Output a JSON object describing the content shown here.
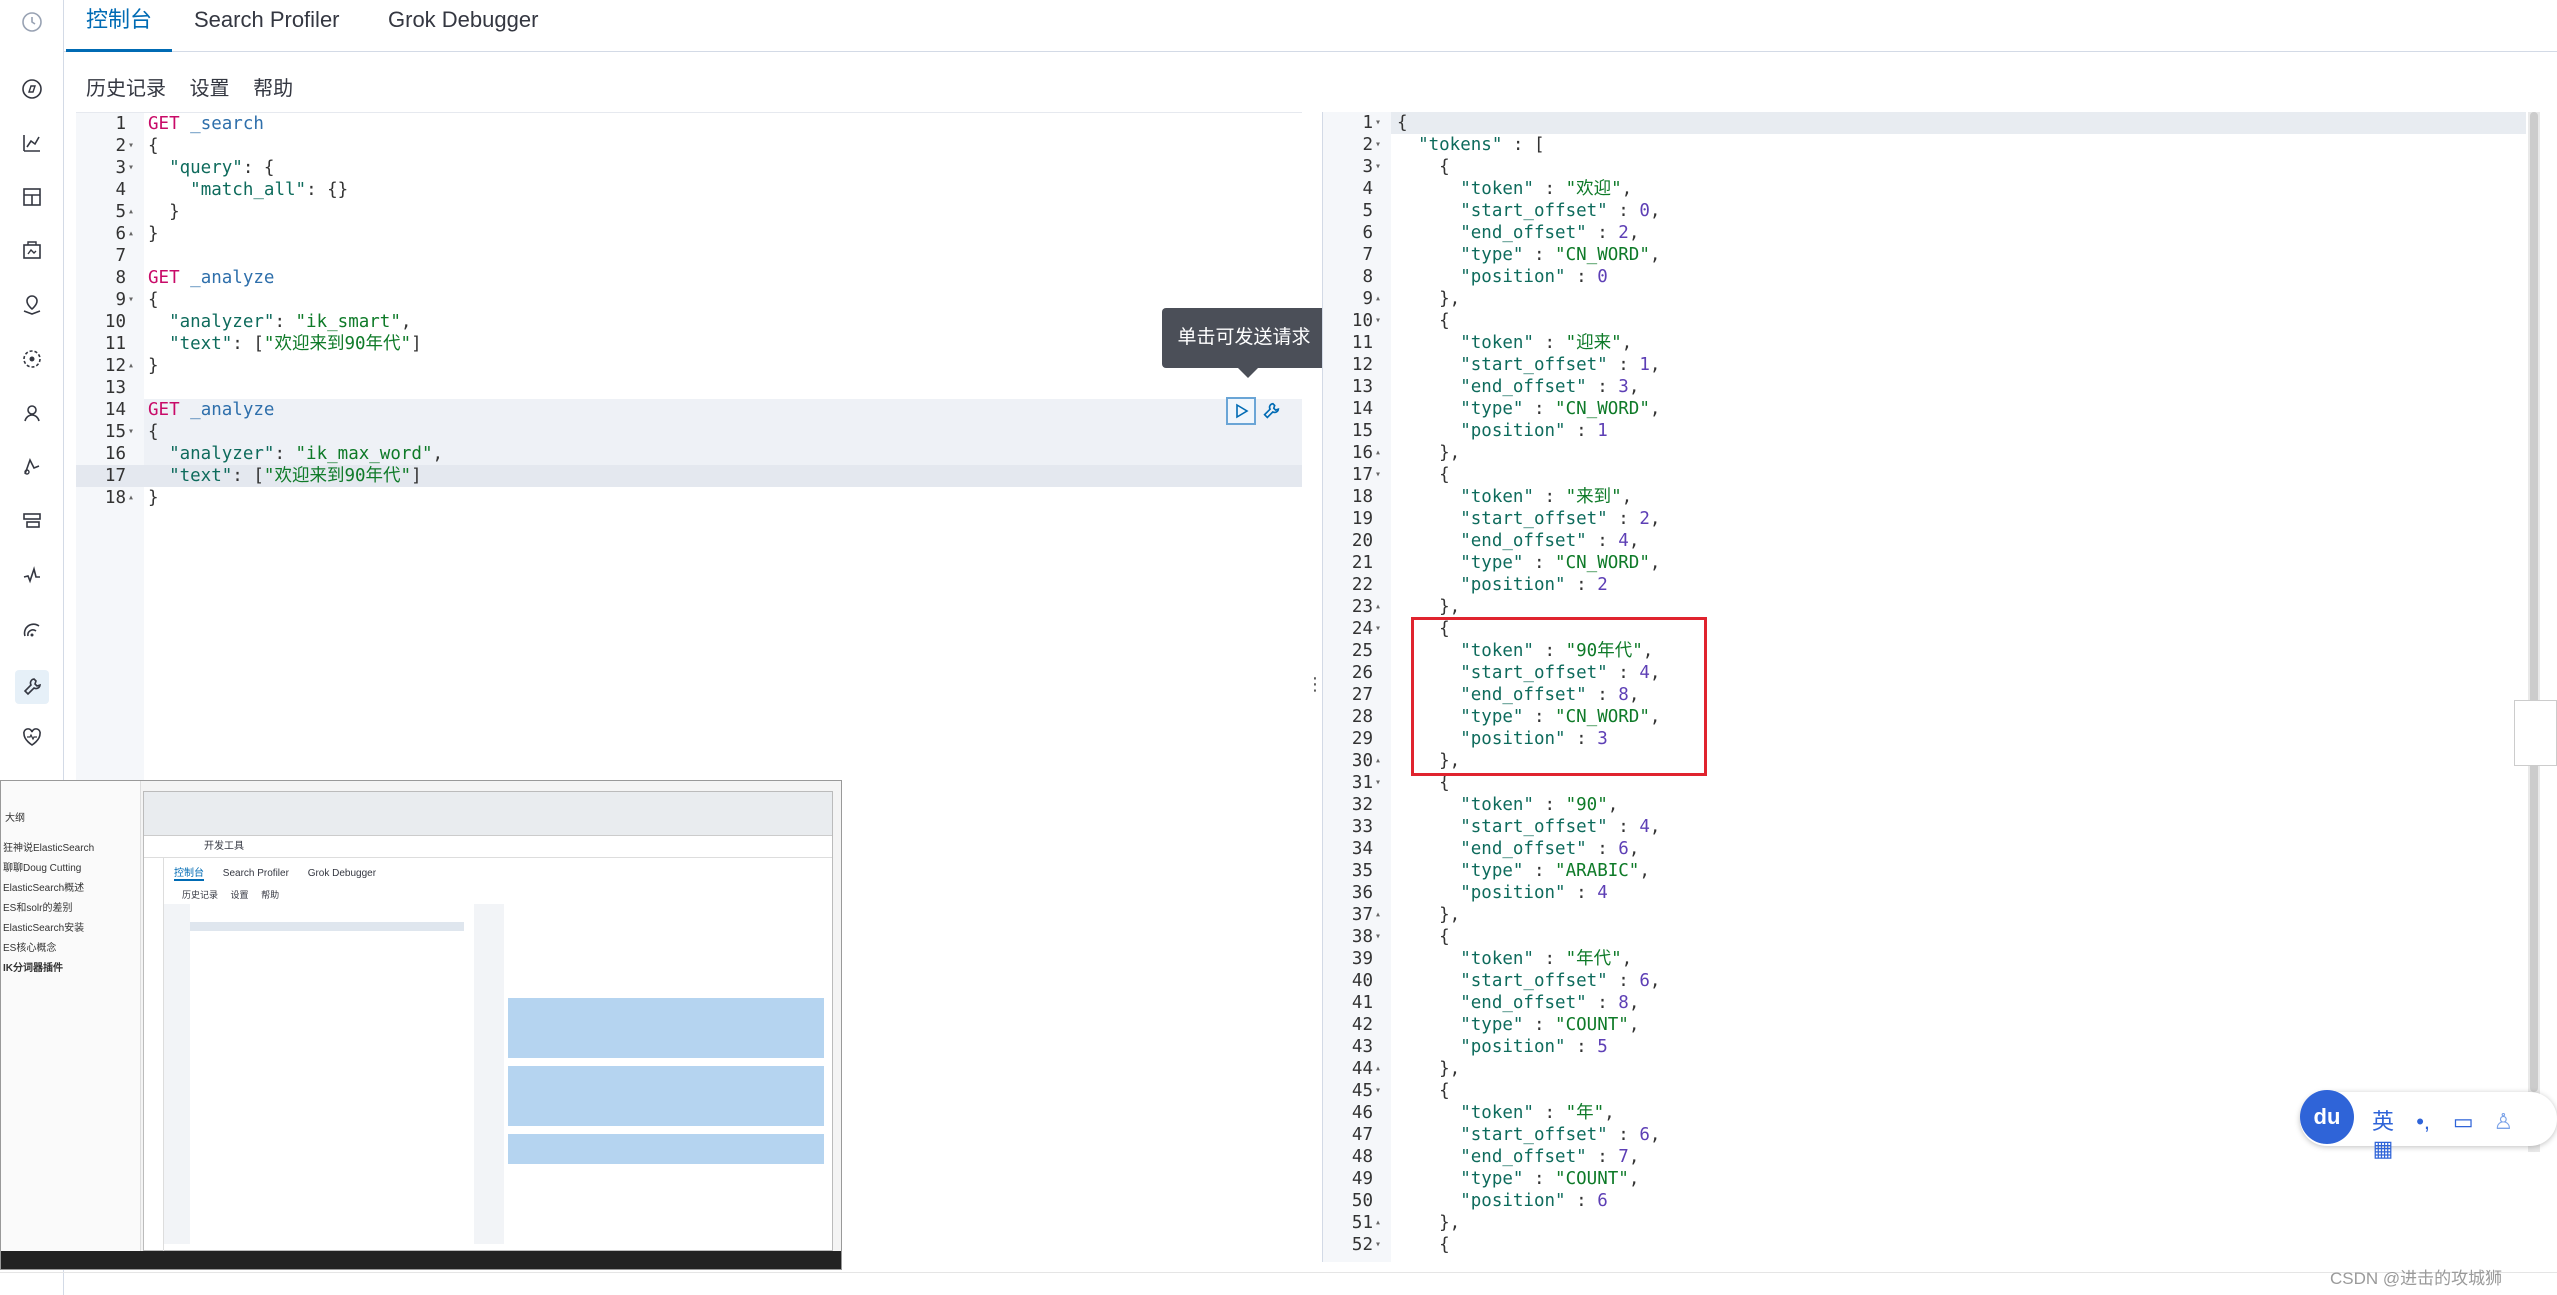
{
  "tabs": {
    "console": "控制台",
    "profiler": "Search Profiler",
    "grok": "Grok Debugger"
  },
  "submenu": {
    "history": "历史记录",
    "settings": "设置",
    "help": "帮助"
  },
  "nav_icons": [
    "compass-icon",
    "visualize-icon",
    "dashboard-icon",
    "canvas-icon",
    "maps-icon",
    "ml-icon",
    "graph-icon",
    "apm-icon",
    "infrastructure-icon",
    "uptime-icon",
    "siem-icon",
    "dev-tools-icon",
    "monitoring-icon"
  ],
  "tooltip": "单击可发送请求",
  "request_lines": [
    {
      "n": "1",
      "fold": "",
      "parts": [
        [
          "k-method",
          "GET "
        ],
        [
          "k-url",
          "_search"
        ]
      ]
    },
    {
      "n": "2",
      "fold": "▾",
      "parts": [
        [
          "k-punc",
          "{"
        ]
      ]
    },
    {
      "n": "3",
      "fold": "▾",
      "parts": [
        [
          "k-punc",
          "  "
        ],
        [
          "k-key",
          "\"query\""
        ],
        [
          "k-punc",
          ": {"
        ]
      ]
    },
    {
      "n": "4",
      "fold": "",
      "parts": [
        [
          "k-punc",
          "    "
        ],
        [
          "k-key",
          "\"match_all\""
        ],
        [
          "k-punc",
          ": {}"
        ]
      ]
    },
    {
      "n": "5",
      "fold": "▴",
      "parts": [
        [
          "k-punc",
          "  }"
        ]
      ]
    },
    {
      "n": "6",
      "fold": "▴",
      "parts": [
        [
          "k-punc",
          "}"
        ]
      ]
    },
    {
      "n": "7",
      "fold": "",
      "parts": []
    },
    {
      "n": "8",
      "fold": "",
      "parts": [
        [
          "k-method",
          "GET "
        ],
        [
          "k-url",
          "_analyze"
        ]
      ]
    },
    {
      "n": "9",
      "fold": "▾",
      "parts": [
        [
          "k-punc",
          "{"
        ]
      ]
    },
    {
      "n": "10",
      "fold": "",
      "parts": [
        [
          "k-punc",
          "  "
        ],
        [
          "k-key",
          "\"analyzer\""
        ],
        [
          "k-punc",
          ": "
        ],
        [
          "k-str",
          "\"ik_smart\""
        ],
        [
          "k-punc",
          ","
        ]
      ]
    },
    {
      "n": "11",
      "fold": "",
      "parts": [
        [
          "k-punc",
          "  "
        ],
        [
          "k-key",
          "\"text\""
        ],
        [
          "k-punc",
          ": ["
        ],
        [
          "k-str",
          "\"欢迎来到90年代\""
        ],
        [
          "k-punc",
          "]"
        ]
      ]
    },
    {
      "n": "12",
      "fold": "▴",
      "parts": [
        [
          "k-punc",
          "}"
        ]
      ]
    },
    {
      "n": "13",
      "fold": "",
      "parts": []
    },
    {
      "n": "14",
      "fold": "",
      "parts": [
        [
          "k-method",
          "GET "
        ],
        [
          "k-url",
          "_analyze"
        ]
      ]
    },
    {
      "n": "15",
      "fold": "▾",
      "parts": [
        [
          "k-punc",
          "{"
        ]
      ]
    },
    {
      "n": "16",
      "fold": "",
      "parts": [
        [
          "k-punc",
          "  "
        ],
        [
          "k-key",
          "\"analyzer\""
        ],
        [
          "k-punc",
          ": "
        ],
        [
          "k-str",
          "\"ik_max_word\""
        ],
        [
          "k-punc",
          ","
        ]
      ]
    },
    {
      "n": "17",
      "fold": "",
      "parts": [
        [
          "k-punc",
          "  "
        ],
        [
          "k-key",
          "\"text\""
        ],
        [
          "k-punc",
          ": ["
        ],
        [
          "k-str",
          "\"欢迎来到90年代\""
        ],
        [
          "k-punc",
          "]"
        ]
      ]
    },
    {
      "n": "18",
      "fold": "▴",
      "parts": [
        [
          "k-punc",
          "}"
        ]
      ]
    }
  ],
  "response_lines": [
    {
      "n": "1",
      "fold": "▾",
      "parts": [
        [
          "k-punc",
          "{"
        ]
      ]
    },
    {
      "n": "2",
      "fold": "▾",
      "parts": [
        [
          "k-punc",
          "  "
        ],
        [
          "k-key",
          "\"tokens\""
        ],
        [
          "k-punc",
          " : ["
        ]
      ]
    },
    {
      "n": "3",
      "fold": "▾",
      "parts": [
        [
          "k-punc",
          "    {"
        ]
      ]
    },
    {
      "n": "4",
      "fold": "",
      "parts": [
        [
          "k-punc",
          "      "
        ],
        [
          "k-key",
          "\"token\""
        ],
        [
          "k-punc",
          " : "
        ],
        [
          "k-str",
          "\"欢迎\""
        ],
        [
          "k-punc",
          ","
        ]
      ]
    },
    {
      "n": "5",
      "fold": "",
      "parts": [
        [
          "k-punc",
          "      "
        ],
        [
          "k-key",
          "\"start_offset\""
        ],
        [
          "k-punc",
          " : "
        ],
        [
          "k-num",
          "0"
        ],
        [
          "k-punc",
          ","
        ]
      ]
    },
    {
      "n": "6",
      "fold": "",
      "parts": [
        [
          "k-punc",
          "      "
        ],
        [
          "k-key",
          "\"end_offset\""
        ],
        [
          "k-punc",
          " : "
        ],
        [
          "k-num",
          "2"
        ],
        [
          "k-punc",
          ","
        ]
      ]
    },
    {
      "n": "7",
      "fold": "",
      "parts": [
        [
          "k-punc",
          "      "
        ],
        [
          "k-key",
          "\"type\""
        ],
        [
          "k-punc",
          " : "
        ],
        [
          "k-str",
          "\"CN_WORD\""
        ],
        [
          "k-punc",
          ","
        ]
      ]
    },
    {
      "n": "8",
      "fold": "",
      "parts": [
        [
          "k-punc",
          "      "
        ],
        [
          "k-key",
          "\"position\""
        ],
        [
          "k-punc",
          " : "
        ],
        [
          "k-num",
          "0"
        ]
      ]
    },
    {
      "n": "9",
      "fold": "▴",
      "parts": [
        [
          "k-punc",
          "    },"
        ]
      ]
    },
    {
      "n": "10",
      "fold": "▾",
      "parts": [
        [
          "k-punc",
          "    {"
        ]
      ]
    },
    {
      "n": "11",
      "fold": "",
      "parts": [
        [
          "k-punc",
          "      "
        ],
        [
          "k-key",
          "\"token\""
        ],
        [
          "k-punc",
          " : "
        ],
        [
          "k-str",
          "\"迎来\""
        ],
        [
          "k-punc",
          ","
        ]
      ]
    },
    {
      "n": "12",
      "fold": "",
      "parts": [
        [
          "k-punc",
          "      "
        ],
        [
          "k-key",
          "\"start_offset\""
        ],
        [
          "k-punc",
          " : "
        ],
        [
          "k-num",
          "1"
        ],
        [
          "k-punc",
          ","
        ]
      ]
    },
    {
      "n": "13",
      "fold": "",
      "parts": [
        [
          "k-punc",
          "      "
        ],
        [
          "k-key",
          "\"end_offset\""
        ],
        [
          "k-punc",
          " : "
        ],
        [
          "k-num",
          "3"
        ],
        [
          "k-punc",
          ","
        ]
      ]
    },
    {
      "n": "14",
      "fold": "",
      "parts": [
        [
          "k-punc",
          "      "
        ],
        [
          "k-key",
          "\"type\""
        ],
        [
          "k-punc",
          " : "
        ],
        [
          "k-str",
          "\"CN_WORD\""
        ],
        [
          "k-punc",
          ","
        ]
      ]
    },
    {
      "n": "15",
      "fold": "",
      "parts": [
        [
          "k-punc",
          "      "
        ],
        [
          "k-key",
          "\"position\""
        ],
        [
          "k-punc",
          " : "
        ],
        [
          "k-num",
          "1"
        ]
      ]
    },
    {
      "n": "16",
      "fold": "▴",
      "parts": [
        [
          "k-punc",
          "    },"
        ]
      ]
    },
    {
      "n": "17",
      "fold": "▾",
      "parts": [
        [
          "k-punc",
          "    {"
        ]
      ]
    },
    {
      "n": "18",
      "fold": "",
      "parts": [
        [
          "k-punc",
          "      "
        ],
        [
          "k-key",
          "\"token\""
        ],
        [
          "k-punc",
          " : "
        ],
        [
          "k-str",
          "\"来到\""
        ],
        [
          "k-punc",
          ","
        ]
      ]
    },
    {
      "n": "19",
      "fold": "",
      "parts": [
        [
          "k-punc",
          "      "
        ],
        [
          "k-key",
          "\"start_offset\""
        ],
        [
          "k-punc",
          " : "
        ],
        [
          "k-num",
          "2"
        ],
        [
          "k-punc",
          ","
        ]
      ]
    },
    {
      "n": "20",
      "fold": "",
      "parts": [
        [
          "k-punc",
          "      "
        ],
        [
          "k-key",
          "\"end_offset\""
        ],
        [
          "k-punc",
          " : "
        ],
        [
          "k-num",
          "4"
        ],
        [
          "k-punc",
          ","
        ]
      ]
    },
    {
      "n": "21",
      "fold": "",
      "parts": [
        [
          "k-punc",
          "      "
        ],
        [
          "k-key",
          "\"type\""
        ],
        [
          "k-punc",
          " : "
        ],
        [
          "k-str",
          "\"CN_WORD\""
        ],
        [
          "k-punc",
          ","
        ]
      ]
    },
    {
      "n": "22",
      "fold": "",
      "parts": [
        [
          "k-punc",
          "      "
        ],
        [
          "k-key",
          "\"position\""
        ],
        [
          "k-punc",
          " : "
        ],
        [
          "k-num",
          "2"
        ]
      ]
    },
    {
      "n": "23",
      "fold": "▴",
      "parts": [
        [
          "k-punc",
          "    },"
        ]
      ]
    },
    {
      "n": "24",
      "fold": "▾",
      "parts": [
        [
          "k-punc",
          "    {"
        ]
      ]
    },
    {
      "n": "25",
      "fold": "",
      "parts": [
        [
          "k-punc",
          "      "
        ],
        [
          "k-key",
          "\"token\""
        ],
        [
          "k-punc",
          " : "
        ],
        [
          "k-str",
          "\"90年代\""
        ],
        [
          "k-punc",
          ","
        ]
      ]
    },
    {
      "n": "26",
      "fold": "",
      "parts": [
        [
          "k-punc",
          "      "
        ],
        [
          "k-key",
          "\"start_offset\""
        ],
        [
          "k-punc",
          " : "
        ],
        [
          "k-num",
          "4"
        ],
        [
          "k-punc",
          ","
        ]
      ]
    },
    {
      "n": "27",
      "fold": "",
      "parts": [
        [
          "k-punc",
          "      "
        ],
        [
          "k-key",
          "\"end_offset\""
        ],
        [
          "k-punc",
          " : "
        ],
        [
          "k-num",
          "8"
        ],
        [
          "k-punc",
          ","
        ]
      ]
    },
    {
      "n": "28",
      "fold": "",
      "parts": [
        [
          "k-punc",
          "      "
        ],
        [
          "k-key",
          "\"type\""
        ],
        [
          "k-punc",
          " : "
        ],
        [
          "k-str",
          "\"CN_WORD\""
        ],
        [
          "k-punc",
          ","
        ]
      ]
    },
    {
      "n": "29",
      "fold": "",
      "parts": [
        [
          "k-punc",
          "      "
        ],
        [
          "k-key",
          "\"position\""
        ],
        [
          "k-punc",
          " : "
        ],
        [
          "k-num",
          "3"
        ]
      ]
    },
    {
      "n": "30",
      "fold": "▴",
      "parts": [
        [
          "k-punc",
          "    },"
        ]
      ]
    },
    {
      "n": "31",
      "fold": "▾",
      "parts": [
        [
          "k-punc",
          "    {"
        ]
      ]
    },
    {
      "n": "32",
      "fold": "",
      "parts": [
        [
          "k-punc",
          "      "
        ],
        [
          "k-key",
          "\"token\""
        ],
        [
          "k-punc",
          " : "
        ],
        [
          "k-str",
          "\"90\""
        ],
        [
          "k-punc",
          ","
        ]
      ]
    },
    {
      "n": "33",
      "fold": "",
      "parts": [
        [
          "k-punc",
          "      "
        ],
        [
          "k-key",
          "\"start_offset\""
        ],
        [
          "k-punc",
          " : "
        ],
        [
          "k-num",
          "4"
        ],
        [
          "k-punc",
          ","
        ]
      ]
    },
    {
      "n": "34",
      "fold": "",
      "parts": [
        [
          "k-punc",
          "      "
        ],
        [
          "k-key",
          "\"end_offset\""
        ],
        [
          "k-punc",
          " : "
        ],
        [
          "k-num",
          "6"
        ],
        [
          "k-punc",
          ","
        ]
      ]
    },
    {
      "n": "35",
      "fold": "",
      "parts": [
        [
          "k-punc",
          "      "
        ],
        [
          "k-key",
          "\"type\""
        ],
        [
          "k-punc",
          " : "
        ],
        [
          "k-str",
          "\"ARABIC\""
        ],
        [
          "k-punc",
          ","
        ]
      ]
    },
    {
      "n": "36",
      "fold": "",
      "parts": [
        [
          "k-punc",
          "      "
        ],
        [
          "k-key",
          "\"position\""
        ],
        [
          "k-punc",
          " : "
        ],
        [
          "k-num",
          "4"
        ]
      ]
    },
    {
      "n": "37",
      "fold": "▴",
      "parts": [
        [
          "k-punc",
          "    },"
        ]
      ]
    },
    {
      "n": "38",
      "fold": "▾",
      "parts": [
        [
          "k-punc",
          "    {"
        ]
      ]
    },
    {
      "n": "39",
      "fold": "",
      "parts": [
        [
          "k-punc",
          "      "
        ],
        [
          "k-key",
          "\"token\""
        ],
        [
          "k-punc",
          " : "
        ],
        [
          "k-str",
          "\"年代\""
        ],
        [
          "k-punc",
          ","
        ]
      ]
    },
    {
      "n": "40",
      "fold": "",
      "parts": [
        [
          "k-punc",
          "      "
        ],
        [
          "k-key",
          "\"start_offset\""
        ],
        [
          "k-punc",
          " : "
        ],
        [
          "k-num",
          "6"
        ],
        [
          "k-punc",
          ","
        ]
      ]
    },
    {
      "n": "41",
      "fold": "",
      "parts": [
        [
          "k-punc",
          "      "
        ],
        [
          "k-key",
          "\"end_offset\""
        ],
        [
          "k-punc",
          " : "
        ],
        [
          "k-num",
          "8"
        ],
        [
          "k-punc",
          ","
        ]
      ]
    },
    {
      "n": "42",
      "fold": "",
      "parts": [
        [
          "k-punc",
          "      "
        ],
        [
          "k-key",
          "\"type\""
        ],
        [
          "k-punc",
          " : "
        ],
        [
          "k-str",
          "\"COUNT\""
        ],
        [
          "k-punc",
          ","
        ]
      ]
    },
    {
      "n": "43",
      "fold": "",
      "parts": [
        [
          "k-punc",
          "      "
        ],
        [
          "k-key",
          "\"position\""
        ],
        [
          "k-punc",
          " : "
        ],
        [
          "k-num",
          "5"
        ]
      ]
    },
    {
      "n": "44",
      "fold": "▴",
      "parts": [
        [
          "k-punc",
          "    },"
        ]
      ]
    },
    {
      "n": "45",
      "fold": "▾",
      "parts": [
        [
          "k-punc",
          "    {"
        ]
      ]
    },
    {
      "n": "46",
      "fold": "",
      "parts": [
        [
          "k-punc",
          "      "
        ],
        [
          "k-key",
          "\"token\""
        ],
        [
          "k-punc",
          " : "
        ],
        [
          "k-str",
          "\"年\""
        ],
        [
          "k-punc",
          ","
        ]
      ]
    },
    {
      "n": "47",
      "fold": "",
      "parts": [
        [
          "k-punc",
          "      "
        ],
        [
          "k-key",
          "\"start_offset\""
        ],
        [
          "k-punc",
          " : "
        ],
        [
          "k-num",
          "6"
        ],
        [
          "k-punc",
          ","
        ]
      ]
    },
    {
      "n": "48",
      "fold": "",
      "parts": [
        [
          "k-punc",
          "      "
        ],
        [
          "k-key",
          "\"end_offset\""
        ],
        [
          "k-punc",
          " : "
        ],
        [
          "k-num",
          "7"
        ],
        [
          "k-punc",
          ","
        ]
      ]
    },
    {
      "n": "49",
      "fold": "",
      "parts": [
        [
          "k-punc",
          "      "
        ],
        [
          "k-key",
          "\"type\""
        ],
        [
          "k-punc",
          " : "
        ],
        [
          "k-str",
          "\"COUNT\""
        ],
        [
          "k-punc",
          ","
        ]
      ]
    },
    {
      "n": "50",
      "fold": "",
      "parts": [
        [
          "k-punc",
          "      "
        ],
        [
          "k-key",
          "\"position\""
        ],
        [
          "k-punc",
          " : "
        ],
        [
          "k-num",
          "6"
        ]
      ]
    },
    {
      "n": "51",
      "fold": "▴",
      "parts": [
        [
          "k-punc",
          "    },"
        ]
      ]
    },
    {
      "n": "52",
      "fold": "▾",
      "parts": [
        [
          "k-punc",
          "    {"
        ]
      ]
    }
  ],
  "thumbnail": {
    "outline_header": "大纲",
    "outline_items": [
      "狂神说ElasticSearch",
      "聊聊Doug Cutting",
      "ElasticSearch概述",
      "ES和solr的差别",
      "ElasticSearch安装",
      "ES核心概念",
      "IK分词器插件"
    ],
    "devtools_label": "开发工具",
    "tabs": [
      "控制台",
      "Search Profiler",
      "Grok Debugger"
    ],
    "submenu": [
      "历史记录",
      "设置",
      "帮助"
    ]
  },
  "ime": {
    "logo": "du",
    "lang": "英"
  },
  "watermark": "CSDN @进击的攻城狮"
}
